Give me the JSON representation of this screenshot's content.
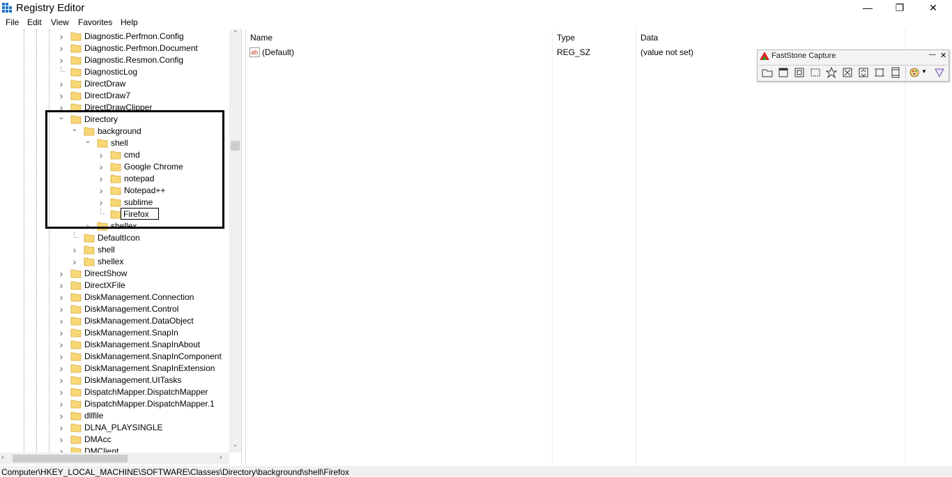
{
  "window": {
    "title": "Registry Editor",
    "controls": [
      "—",
      "❐",
      "✕"
    ]
  },
  "menu": [
    "File",
    "Edit",
    "View",
    "Favorites",
    "Help"
  ],
  "tree": [
    {
      "label": "Diagnostic.Perfmon.Config",
      "depth": 0,
      "chevron": "right"
    },
    {
      "label": "Diagnostic.Perfmon.Document",
      "depth": 0,
      "chevron": "right"
    },
    {
      "label": "Diagnostic.Resmon.Config",
      "depth": 0,
      "chevron": "right"
    },
    {
      "label": "DiagnosticLog",
      "depth": 0,
      "chevron": "none"
    },
    {
      "label": "DirectDraw",
      "depth": 0,
      "chevron": "right"
    },
    {
      "label": "DirectDraw7",
      "depth": 0,
      "chevron": "right"
    },
    {
      "label": "DirectDrawClipper",
      "depth": 0,
      "chevron": "right"
    },
    {
      "label": "Directory",
      "depth": 0,
      "chevron": "down"
    },
    {
      "label": "background",
      "depth": 1,
      "chevron": "down"
    },
    {
      "label": "shell",
      "depth": 2,
      "chevron": "down"
    },
    {
      "label": "cmd",
      "depth": 3,
      "chevron": "right"
    },
    {
      "label": "Google Chrome",
      "depth": 3,
      "chevron": "right"
    },
    {
      "label": "notepad",
      "depth": 3,
      "chevron": "right"
    },
    {
      "label": "Notepad++",
      "depth": 3,
      "chevron": "right"
    },
    {
      "label": "sublime",
      "depth": 3,
      "chevron": "right"
    },
    {
      "label": "",
      "depth": 3,
      "chevron": "none",
      "editing": true
    },
    {
      "label": "shellex",
      "depth": 2,
      "chevron": "right"
    },
    {
      "label": "DefaultIcon",
      "depth": 1,
      "chevron": "none"
    },
    {
      "label": "shell",
      "depth": 1,
      "chevron": "right"
    },
    {
      "label": "shellex",
      "depth": 1,
      "chevron": "right"
    },
    {
      "label": "DirectShow",
      "depth": 0,
      "chevron": "right"
    },
    {
      "label": "DirectXFile",
      "depth": 0,
      "chevron": "right"
    },
    {
      "label": "DiskManagement.Connection",
      "depth": 0,
      "chevron": "right"
    },
    {
      "label": "DiskManagement.Control",
      "depth": 0,
      "chevron": "right"
    },
    {
      "label": "DiskManagement.DataObject",
      "depth": 0,
      "chevron": "right"
    },
    {
      "label": "DiskManagement.SnapIn",
      "depth": 0,
      "chevron": "right"
    },
    {
      "label": "DiskManagement.SnapInAbout",
      "depth": 0,
      "chevron": "right"
    },
    {
      "label": "DiskManagement.SnapInComponent",
      "depth": 0,
      "chevron": "right"
    },
    {
      "label": "DiskManagement.SnapInExtension",
      "depth": 0,
      "chevron": "right"
    },
    {
      "label": "DiskManagement.UITasks",
      "depth": 0,
      "chevron": "right"
    },
    {
      "label": "DispatchMapper.DispatchMapper",
      "depth": 0,
      "chevron": "right"
    },
    {
      "label": "DispatchMapper.DispatchMapper.1",
      "depth": 0,
      "chevron": "right"
    },
    {
      "label": "dllfile",
      "depth": 0,
      "chevron": "right"
    },
    {
      "label": "DLNA_PLAYSINGLE",
      "depth": 0,
      "chevron": "right"
    },
    {
      "label": "DMAcc",
      "depth": 0,
      "chevron": "right"
    },
    {
      "label": "DMClient",
      "depth": 0,
      "chevron": "right"
    }
  ],
  "rename_value": "Firefox",
  "list": {
    "columns": [
      "Name",
      "Type",
      "Data"
    ],
    "rows": [
      {
        "name": "(Default)",
        "type": "REG_SZ",
        "data": "(value not set)"
      }
    ]
  },
  "statusbar": {
    "path": "Computer\\HKEY_LOCAL_MACHINE\\SOFTWARE\\Classes\\Directory\\background\\shell\\Firefox"
  },
  "faststone": {
    "title": "FastStone Capture",
    "min": "—",
    "close": "✕"
  },
  "colors": {
    "folder_fill": "#f8d775",
    "folder_edge": "#d8a93a",
    "highlight_border": "#000000"
  }
}
